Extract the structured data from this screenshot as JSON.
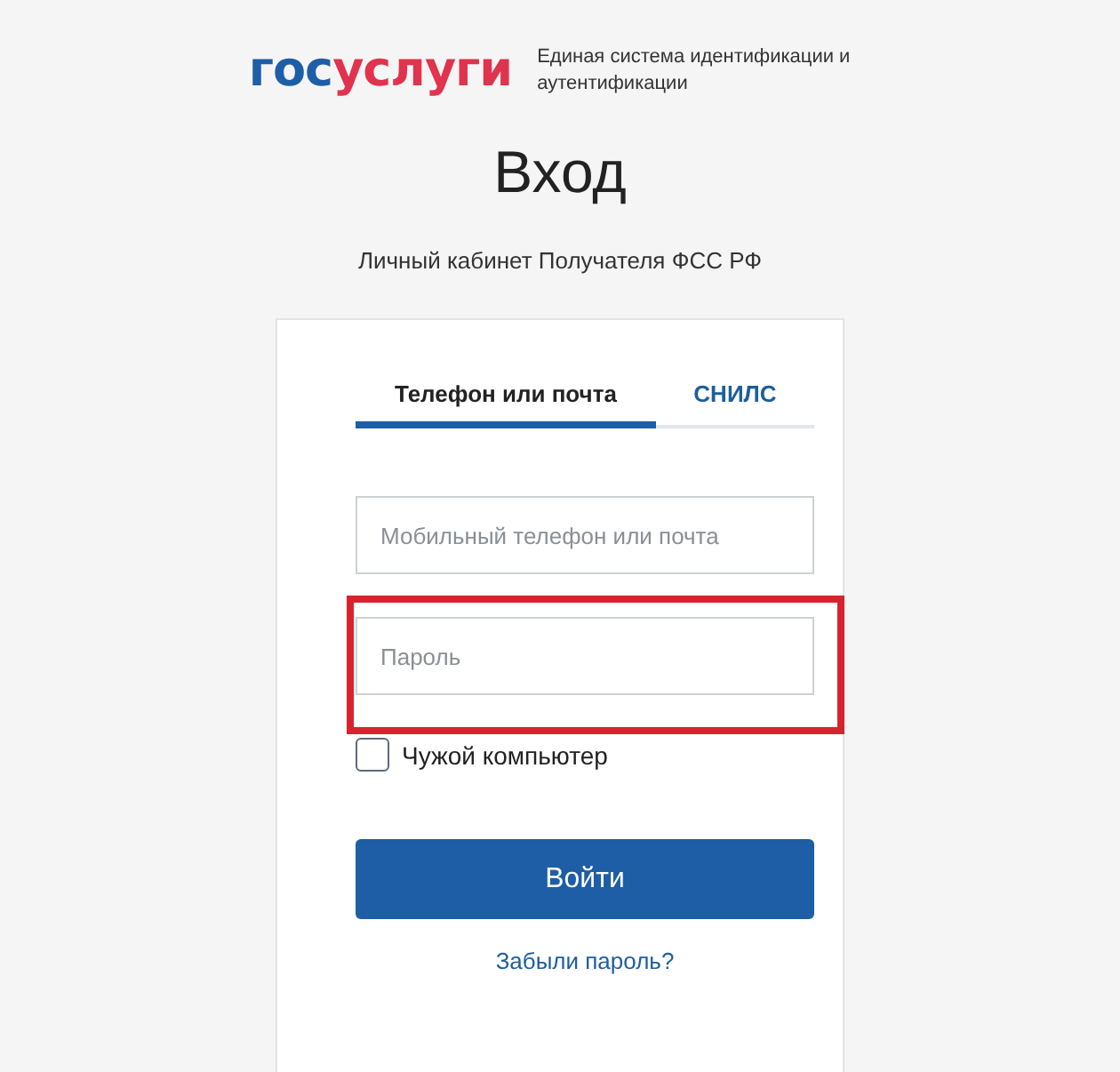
{
  "logo": {
    "parts": [
      {
        "text": "гос",
        "color": "#1d5ea6"
      },
      {
        "text": "услуги",
        "color": "#e0334d"
      }
    ],
    "tagline": "Единая система идентификации и аутентификации"
  },
  "title": "Вход",
  "subtitle": "Личный кабинет Получателя ФСС РФ",
  "tabs": [
    {
      "label": "Телефон или почта",
      "selected": true
    },
    {
      "label": "СНИЛС",
      "selected": false
    }
  ],
  "login_field": {
    "placeholder": "Мобильный телефон или почта"
  },
  "password_field": {
    "placeholder": "Пароль",
    "highlighted": true
  },
  "remember_checkbox": {
    "label": "Чужой компьютер",
    "checked": false
  },
  "submit_button": "Войти",
  "forgot_link": "Забыли пароль?"
}
